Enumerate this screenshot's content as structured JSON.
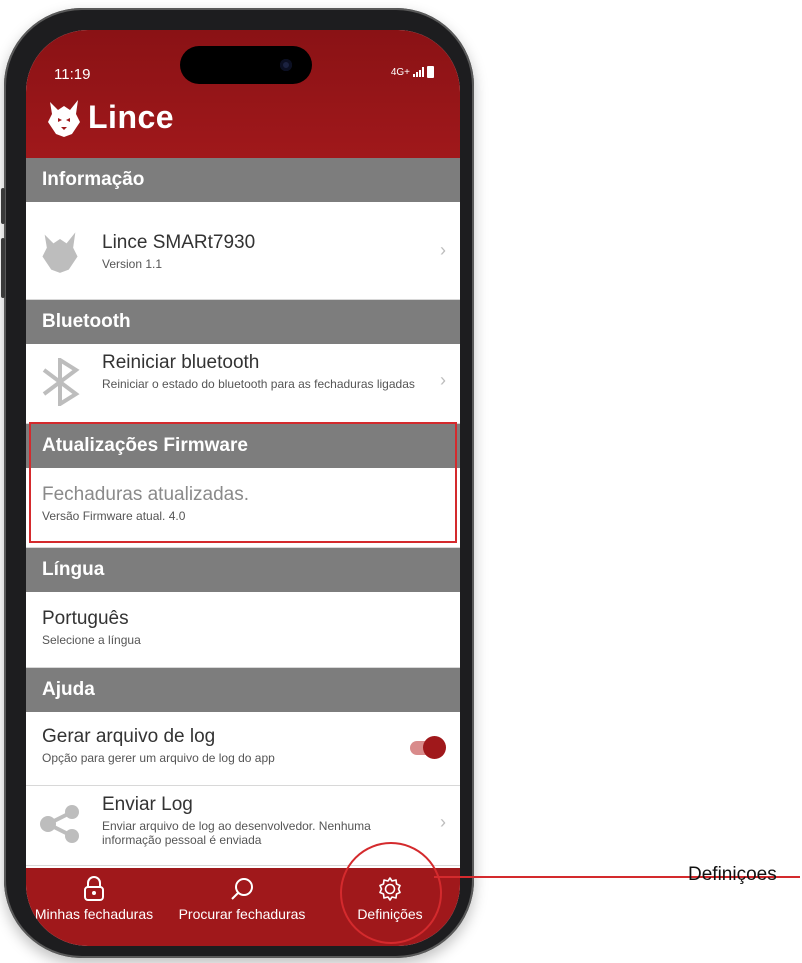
{
  "status_bar": {
    "time": "11:19",
    "network": "4G+"
  },
  "app": {
    "name": "Lince"
  },
  "sections": {
    "info": {
      "title": "Informação",
      "device_name": "Lince SMARt7930",
      "version": "Version 1.1"
    },
    "bluetooth": {
      "title": "Bluetooth",
      "reset_title": "Reiniciar bluetooth",
      "reset_sub": "Reiniciar o estado do bluetooth para as fechaduras ligadas"
    },
    "firmware": {
      "title": "Atualizações Firmware",
      "status": "Fechaduras atualizadas.",
      "version": "Versão Firmware atual. 4.0"
    },
    "language": {
      "title": "Língua",
      "value": "Português",
      "sub": "Selecione a língua"
    },
    "help": {
      "title": "Ajuda",
      "log_title": "Gerar arquivo de log",
      "log_sub": "Opção para gerer um arquivo de log do app",
      "log_enabled": true,
      "send_title": "Enviar Log",
      "send_sub": "Enviar arquivo de log ao desenvolvedor. Nenhuma informação pessoal é enviada"
    }
  },
  "tabs": [
    {
      "label": "Minhas fechaduras",
      "icon": "lock-icon"
    },
    {
      "label": "Procurar fechaduras",
      "icon": "search-icon"
    },
    {
      "label": "Definições",
      "icon": "gear-icon",
      "active": true
    }
  ],
  "callout": {
    "label": "Definiçoes"
  },
  "colors": {
    "brand_red": "#a0181b",
    "section_gray": "#7d7d7d",
    "highlight": "#d42a2d"
  }
}
